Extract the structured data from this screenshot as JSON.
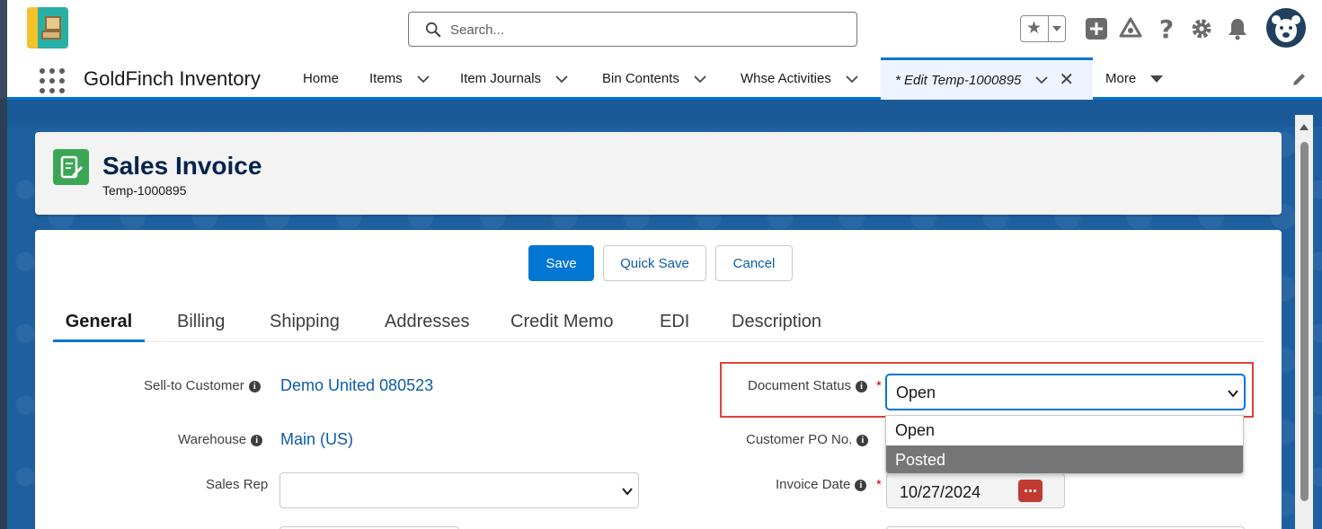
{
  "header": {
    "search_placeholder": "Search...",
    "icons": [
      "favorites-star-icon",
      "add-icon",
      "trailhead-icon",
      "help-icon",
      "setup-gear-icon",
      "notifications-bell-icon",
      "user-avatar"
    ]
  },
  "nav": {
    "app_name": "GoldFinch Inventory",
    "items": [
      {
        "label": "Home"
      },
      {
        "label": "Items"
      },
      {
        "label": "Item Journals"
      },
      {
        "label": "Bin Contents"
      },
      {
        "label": "Whse Activities"
      },
      {
        "label": "* Edit Temp-1000895"
      },
      {
        "label": "More"
      }
    ]
  },
  "record": {
    "object_label": "Sales Invoice",
    "record_name": "Temp-1000895"
  },
  "actions": {
    "save": "Save",
    "quick_save": "Quick Save",
    "cancel": "Cancel"
  },
  "tabs": [
    {
      "label": "General"
    },
    {
      "label": "Billing"
    },
    {
      "label": "Shipping"
    },
    {
      "label": "Addresses"
    },
    {
      "label": "Credit Memo"
    },
    {
      "label": "EDI"
    },
    {
      "label": "Description"
    }
  ],
  "fields": {
    "sell_to_customer": {
      "label": "Sell-to Customer",
      "value": "Demo United 080523"
    },
    "warehouse": {
      "label": "Warehouse",
      "value": "Main (US)"
    },
    "sales_rep": {
      "label": "Sales Rep",
      "value": ""
    },
    "document_status": {
      "label": "Document Status",
      "value": "Open",
      "required": "*",
      "options": [
        "Open",
        "Posted"
      ]
    },
    "customer_po": {
      "label": "Customer PO No."
    },
    "invoice_date": {
      "label": "Invoice Date",
      "value": "10/27/2024",
      "required": "*"
    }
  },
  "colors": {
    "brand_blue": "#0176d3",
    "highlight_red": "#e0403d",
    "record_icon_green": "#3ba755",
    "date_button_red": "#c23934"
  }
}
